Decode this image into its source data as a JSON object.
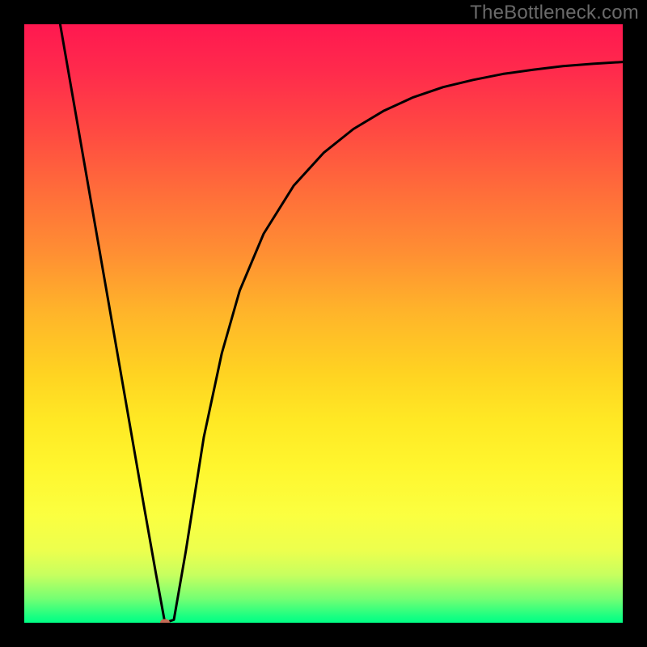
{
  "watermark": "TheBottleneck.com",
  "chart_data": {
    "type": "line",
    "title": "",
    "xlabel": "",
    "ylabel": "",
    "x_range": [
      0,
      1
    ],
    "y_range": [
      0,
      1
    ],
    "axes_visible": false,
    "background_gradient": {
      "direction": "vertical",
      "stops": [
        {
          "pos": 0.0,
          "color": "#ff1850"
        },
        {
          "pos": 0.5,
          "color": "#ffb42a"
        },
        {
          "pos": 0.8,
          "color": "#fbff40"
        },
        {
          "pos": 1.0,
          "color": "#00ff85"
        }
      ]
    },
    "series": [
      {
        "name": "bottleneck-curve",
        "color": "#000000",
        "stroke_width": 3,
        "x": [
          0.06,
          0.08,
          0.1,
          0.12,
          0.14,
          0.16,
          0.18,
          0.2,
          0.22,
          0.235,
          0.25,
          0.27,
          0.3,
          0.33,
          0.36,
          0.4,
          0.45,
          0.5,
          0.55,
          0.6,
          0.65,
          0.7,
          0.75,
          0.8,
          0.85,
          0.9,
          0.95,
          1.0
        ],
        "y": [
          1.0,
          0.885,
          0.77,
          0.655,
          0.54,
          0.425,
          0.31,
          0.195,
          0.082,
          0.0,
          0.005,
          0.12,
          0.31,
          0.45,
          0.555,
          0.65,
          0.73,
          0.785,
          0.825,
          0.855,
          0.878,
          0.895,
          0.907,
          0.917,
          0.924,
          0.93,
          0.934,
          0.937
        ]
      }
    ],
    "minimum_marker": {
      "x": 0.235,
      "y": 0.0,
      "color": "#c46a55"
    }
  }
}
